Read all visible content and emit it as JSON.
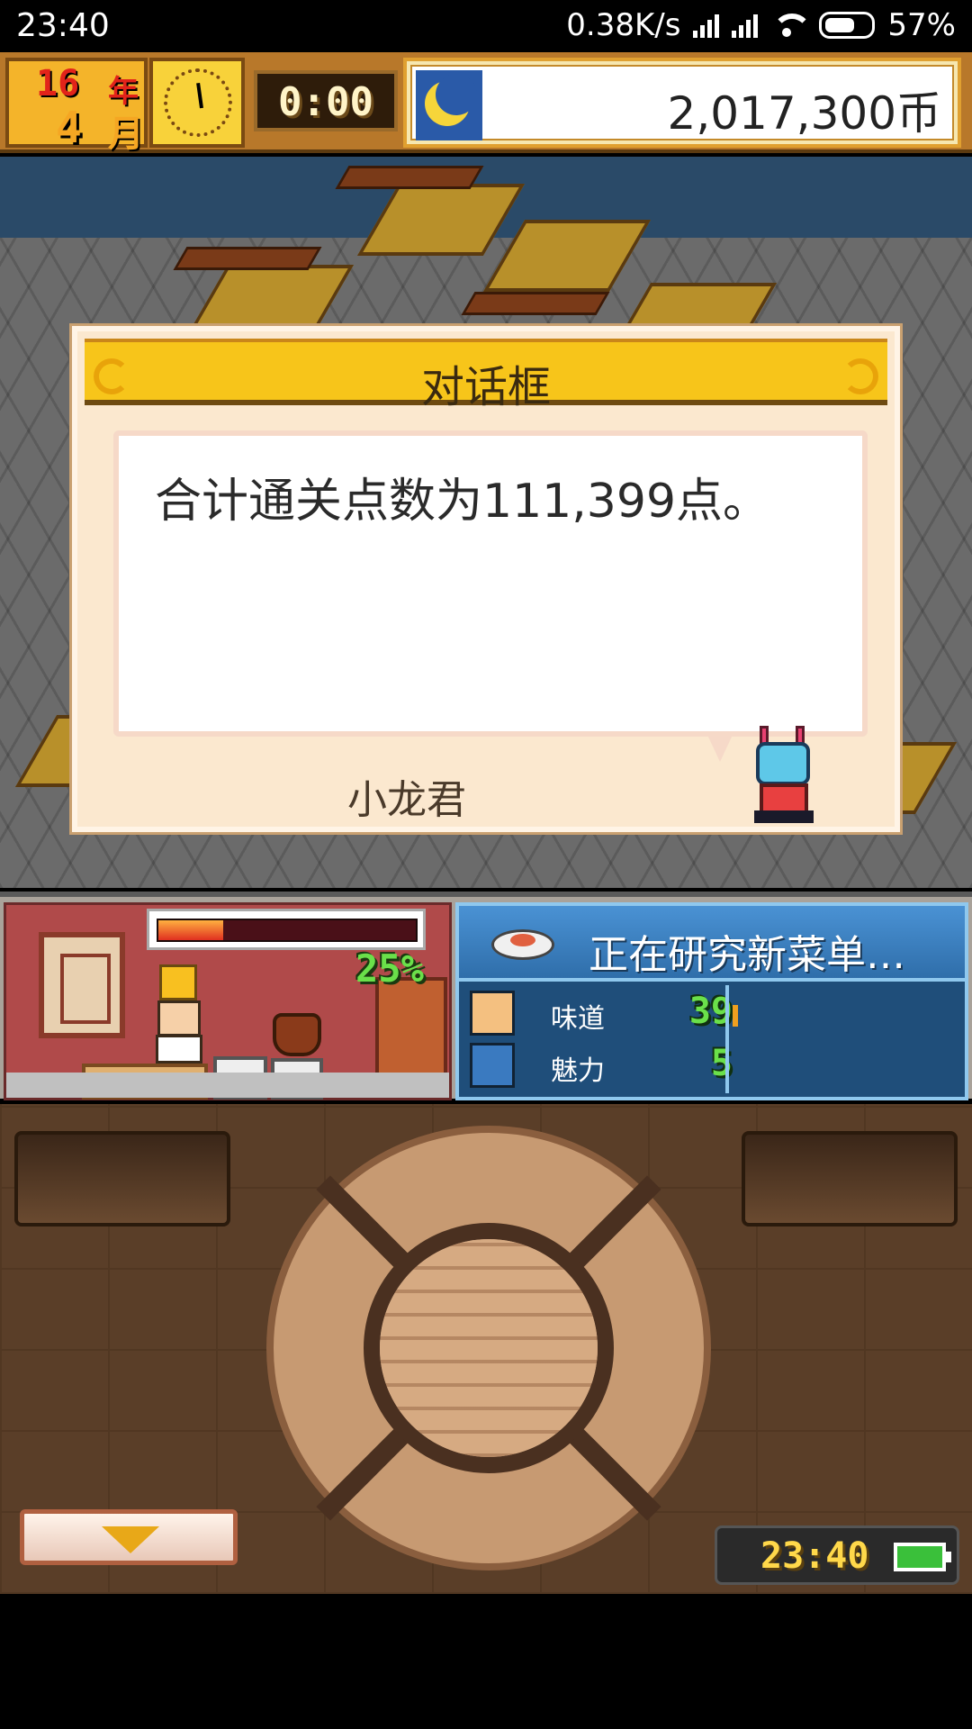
{
  "status_bar": {
    "time": "23:40",
    "network_speed": "0.38K/s",
    "battery": "57%"
  },
  "hud": {
    "year_number": "16",
    "year_unit": "年",
    "month_number": "4",
    "month_unit": "月",
    "timer": "0:00",
    "money": "2,017,300币",
    "icons": [
      "clock-icon",
      "moon-icon"
    ]
  },
  "dialog": {
    "title": "对话框",
    "message": "合计通关点数为111,399点。",
    "speaker": "小龙君"
  },
  "kitchen": {
    "progress_percent": 25,
    "progress_label": "25%"
  },
  "research": {
    "title": "正在研究新菜单…",
    "stats": [
      {
        "label": "味道",
        "value": "39",
        "icon": "taste-face-icon"
      },
      {
        "label": "魅力",
        "value": "5",
        "icon": "charm-dish-icon"
      }
    ]
  },
  "controls": {
    "clock": "23:40",
    "down_button_icon": "down-arrow-icon"
  },
  "colors": {
    "hud_gold": "#f4b42a",
    "research_blue": "#1f4e7a",
    "stat_green": "#6ae04a",
    "dialog_header": "#f7c51a"
  }
}
